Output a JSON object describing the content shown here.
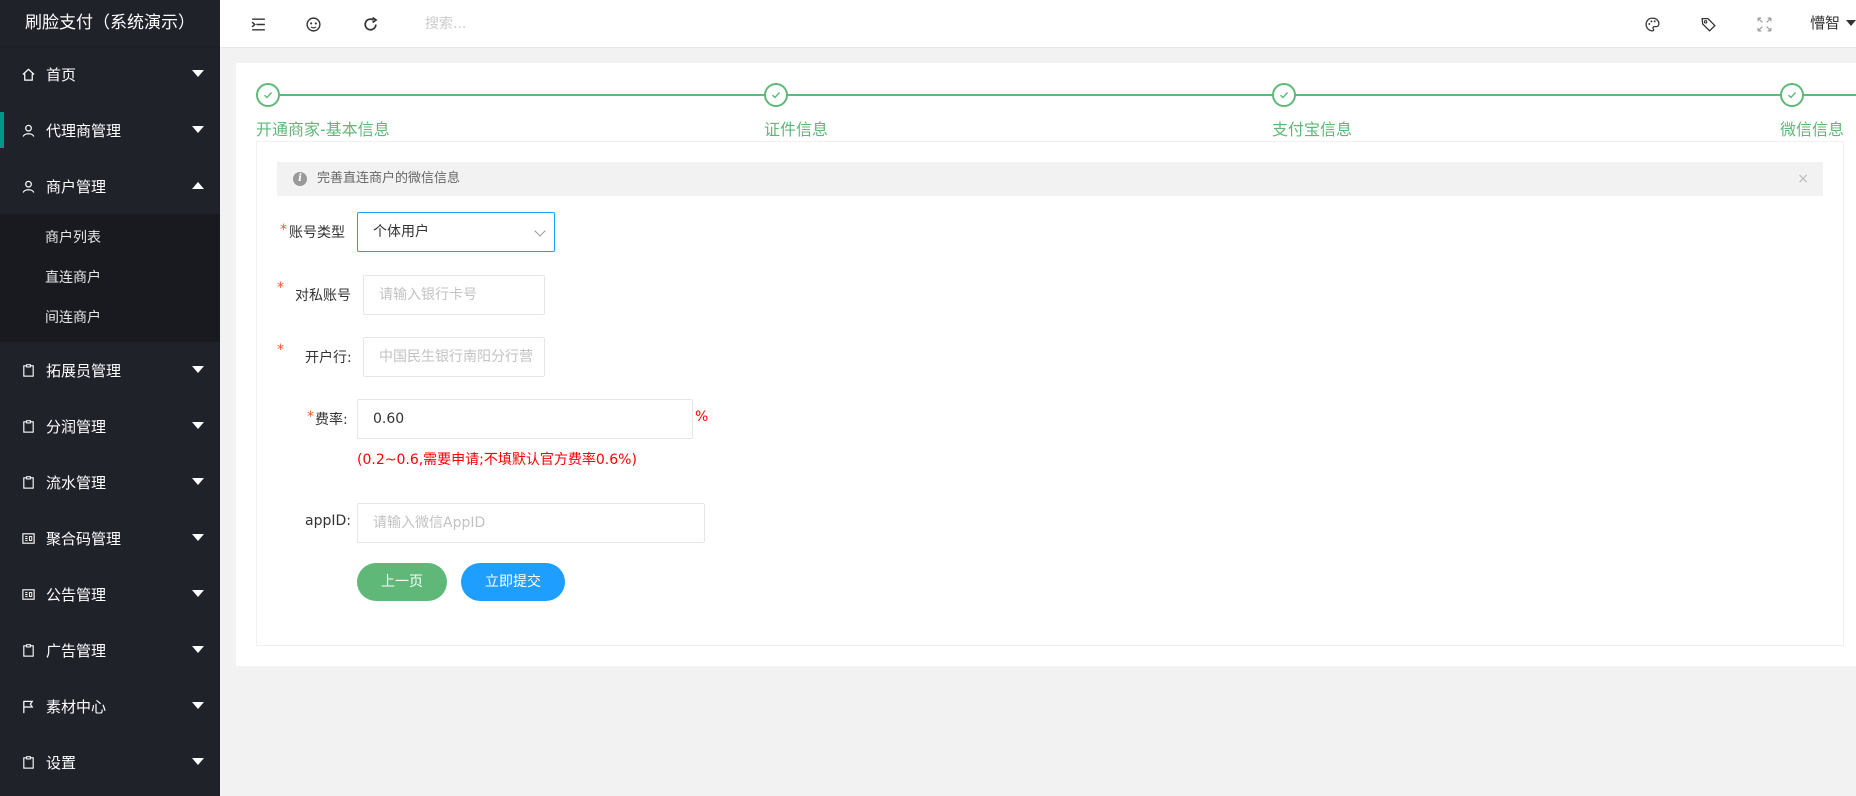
{
  "app": {
    "title": "刷脸支付（系统演示）"
  },
  "sidebar": {
    "items": [
      {
        "label": "首页",
        "icon": "home-icon"
      },
      {
        "label": "代理商管理",
        "icon": "user-icon"
      },
      {
        "label": "商户管理",
        "icon": "user-icon",
        "expanded": true,
        "children": [
          "商户列表",
          "直连商户",
          "间连商户"
        ]
      },
      {
        "label": "拓展员管理",
        "icon": "clipboard-icon"
      },
      {
        "label": "分润管理",
        "icon": "clipboard-icon"
      },
      {
        "label": "流水管理",
        "icon": "clipboard-icon"
      },
      {
        "label": "聚合码管理",
        "icon": "news-icon"
      },
      {
        "label": "公告管理",
        "icon": "news-icon"
      },
      {
        "label": "广告管理",
        "icon": "clipboard-icon"
      },
      {
        "label": "素材中心",
        "icon": "flag-icon"
      },
      {
        "label": "设置",
        "icon": "clipboard-icon"
      }
    ]
  },
  "header": {
    "search_placeholder": "搜索...",
    "user_name": "懵智"
  },
  "steps": [
    {
      "label": "开通商家-基本信息",
      "done": true
    },
    {
      "label": "证件信息",
      "done": true
    },
    {
      "label": "支付宝信息",
      "done": true
    },
    {
      "label": "微信信息",
      "done": true
    }
  ],
  "form": {
    "tip": "完善直连商户的微信信息",
    "tip_close": "×",
    "account_type": {
      "label": "账号类型",
      "value": "个体用户"
    },
    "private_account": {
      "label": "对私账号",
      "placeholder": "请输入银行卡号"
    },
    "bank": {
      "label": "开户行:",
      "placeholder": "中国民生银行南阳分行营"
    },
    "rate": {
      "label": "费率:",
      "value": "0.60",
      "unit": "%",
      "hint": "(0.2~0.6,需要申请;不填默认官方费率0.6%)"
    },
    "appid": {
      "label": "appID:",
      "placeholder": "请输入微信AppID"
    },
    "prev_button": "上一页",
    "submit_button": "立即提交"
  },
  "colors": {
    "sidebar_bg": "#20222a",
    "step_green": "#5fb878",
    "primary_blue": "#1e9fff",
    "required_red": "#ff5722"
  }
}
